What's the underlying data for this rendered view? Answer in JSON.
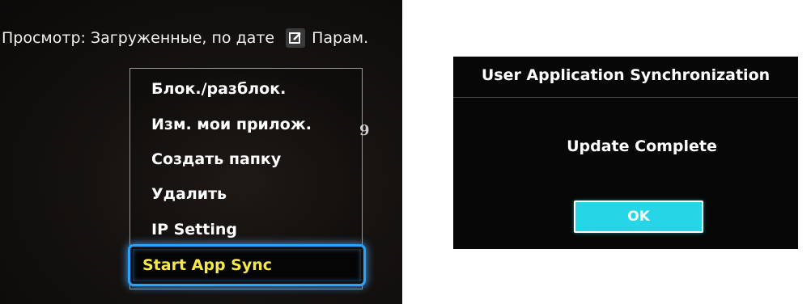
{
  "left_screen": {
    "view_label": "Просмотр: Загруженные, по дате",
    "params_label": "Парам.",
    "edit_icon": "edit-icon",
    "menu": {
      "items": [
        "Блок./разблок.",
        "Изм. мои прилож.",
        "Создать папку",
        "Удалить",
        "IP Setting",
        "Start App Sync"
      ],
      "selected_index": 5,
      "selected_text_color": "#f5e94a",
      "highlight_color": "#2aa3ff"
    },
    "stray_digit": "9"
  },
  "right_screen": {
    "dialog_title": "User Application Synchronization",
    "message": "Update Complete",
    "ok_label": "OK",
    "ok_color": "#27d6e6"
  }
}
